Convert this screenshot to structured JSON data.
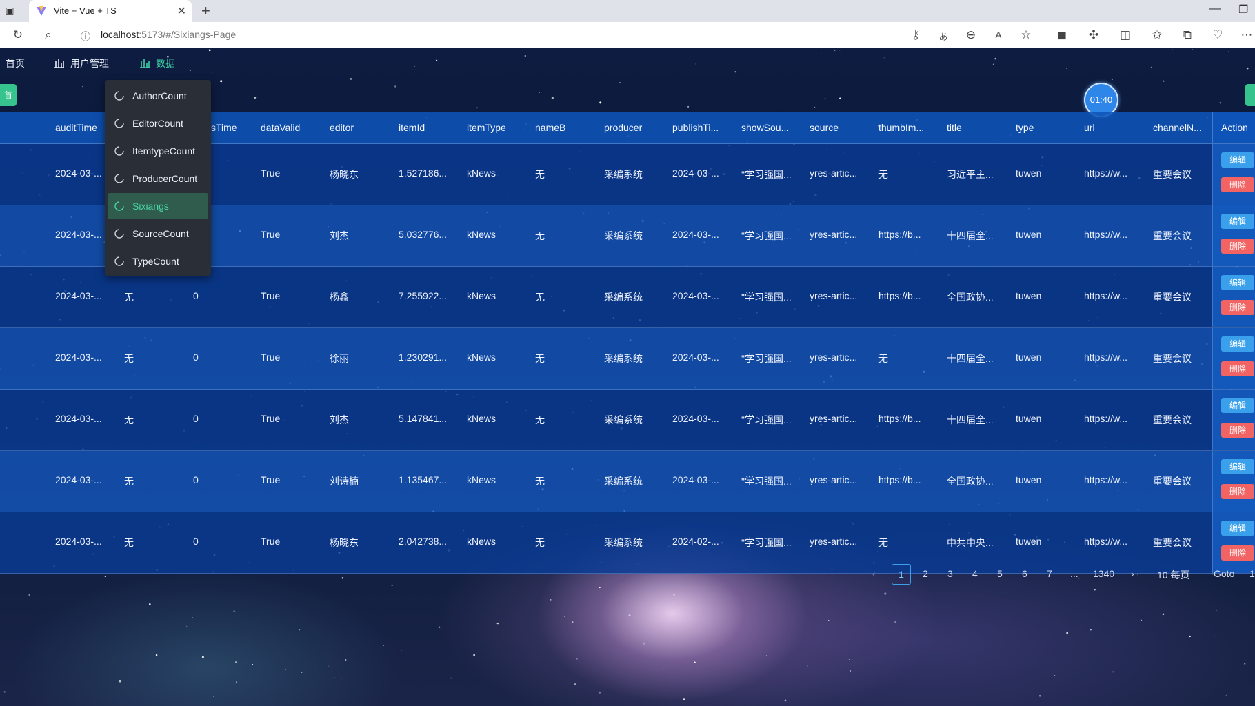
{
  "browser": {
    "tab_title": "Vite + Vue + TS",
    "url_host": "localhost",
    "url_rest": ":5173/#/Sixiangs-Page"
  },
  "nav": {
    "home": "首页",
    "users": "用户管理",
    "data": "数据"
  },
  "side_tab_left": "首",
  "timer": "01:40",
  "dropdown": {
    "items": [
      "AuthorCount",
      "EditorCount",
      "ItemtypeCount",
      "ProducerCount",
      "Sixiangs",
      "SourceCount",
      "TypeCount"
    ],
    "active": "Sixiangs"
  },
  "table": {
    "headers": [
      "auditTime",
      "sTime",
      "dataValid",
      "editor",
      "itemId",
      "itemType",
      "nameB",
      "producer",
      "publishTi...",
      "showSou...",
      "source",
      "thumbIm...",
      "title",
      "type",
      "url",
      "channelN...",
      "Action"
    ],
    "rows": [
      {
        "auditTime": "2024-03-...",
        "c2": "",
        "c3": "",
        "dataValid": "True",
        "editor": "杨晓东",
        "itemId": "1.527186...",
        "itemType": "kNews",
        "nameB": "无",
        "producer": "采编系统",
        "publishTime": "2024-03-...",
        "showSource": "\"学习强国...",
        "source": "yres-artic...",
        "thumb": "无",
        "title": "习近平主...",
        "type": "tuwen",
        "url": "https://w...",
        "channel": "重要会议"
      },
      {
        "auditTime": "2024-03-...",
        "c2": "",
        "c3": "",
        "dataValid": "True",
        "editor": "刘杰",
        "itemId": "5.032776...",
        "itemType": "kNews",
        "nameB": "无",
        "producer": "采编系统",
        "publishTime": "2024-03-...",
        "showSource": "\"学习强国...",
        "source": "yres-artic...",
        "thumb": "https://b...",
        "title": "十四届全...",
        "type": "tuwen",
        "url": "https://w...",
        "channel": "重要会议"
      },
      {
        "auditTime": "2024-03-...",
        "c2": "无",
        "c3": "0",
        "dataValid": "True",
        "editor": "杨鑫",
        "itemId": "7.255922...",
        "itemType": "kNews",
        "nameB": "无",
        "producer": "采编系统",
        "publishTime": "2024-03-...",
        "showSource": "\"学习强国...",
        "source": "yres-artic...",
        "thumb": "https://b...",
        "title": "全国政协...",
        "type": "tuwen",
        "url": "https://w...",
        "channel": "重要会议"
      },
      {
        "auditTime": "2024-03-...",
        "c2": "无",
        "c3": "0",
        "dataValid": "True",
        "editor": "徐丽",
        "itemId": "1.230291...",
        "itemType": "kNews",
        "nameB": "无",
        "producer": "采编系统",
        "publishTime": "2024-03-...",
        "showSource": "\"学习强国...",
        "source": "yres-artic...",
        "thumb": "无",
        "title": "十四届全...",
        "type": "tuwen",
        "url": "https://w...",
        "channel": "重要会议"
      },
      {
        "auditTime": "2024-03-...",
        "c2": "无",
        "c3": "0",
        "dataValid": "True",
        "editor": "刘杰",
        "itemId": "5.147841...",
        "itemType": "kNews",
        "nameB": "无",
        "producer": "采编系统",
        "publishTime": "2024-03-...",
        "showSource": "\"学习强国...",
        "source": "yres-artic...",
        "thumb": "https://b...",
        "title": "十四届全...",
        "type": "tuwen",
        "url": "https://w...",
        "channel": "重要会议"
      },
      {
        "auditTime": "2024-03-...",
        "c2": "无",
        "c3": "0",
        "dataValid": "True",
        "editor": "刘诗楠",
        "itemId": "1.135467...",
        "itemType": "kNews",
        "nameB": "无",
        "producer": "采编系统",
        "publishTime": "2024-03-...",
        "showSource": "\"学习强国...",
        "source": "yres-artic...",
        "thumb": "https://b...",
        "title": "全国政协...",
        "type": "tuwen",
        "url": "https://w...",
        "channel": "重要会议"
      },
      {
        "auditTime": "2024-03-...",
        "c2": "无",
        "c3": "0",
        "dataValid": "True",
        "editor": "杨晓东",
        "itemId": "2.042738...",
        "itemType": "kNews",
        "nameB": "无",
        "producer": "采编系统",
        "publishTime": "2024-02-...",
        "showSource": "\"学习强国...",
        "source": "yres-artic...",
        "thumb": "无",
        "title": "中共中央...",
        "type": "tuwen",
        "url": "https://w...",
        "channel": "重要会议"
      }
    ],
    "edit_label": "编辑",
    "delete_label": "删除"
  },
  "pagination": {
    "prev": "‹",
    "pages": [
      "1",
      "2",
      "3",
      "4",
      "5",
      "6",
      "7"
    ],
    "current": "1",
    "ellipsis": "...",
    "last": "1340",
    "next": "›",
    "page_size": "10 每页",
    "goto_label": "Goto",
    "goto_value": "1"
  },
  "colors": {
    "accent_green": "#36c38e",
    "active_menu_text": "#48d4a6",
    "edit_button": "#3aa0ec",
    "delete_button": "#f26363"
  }
}
